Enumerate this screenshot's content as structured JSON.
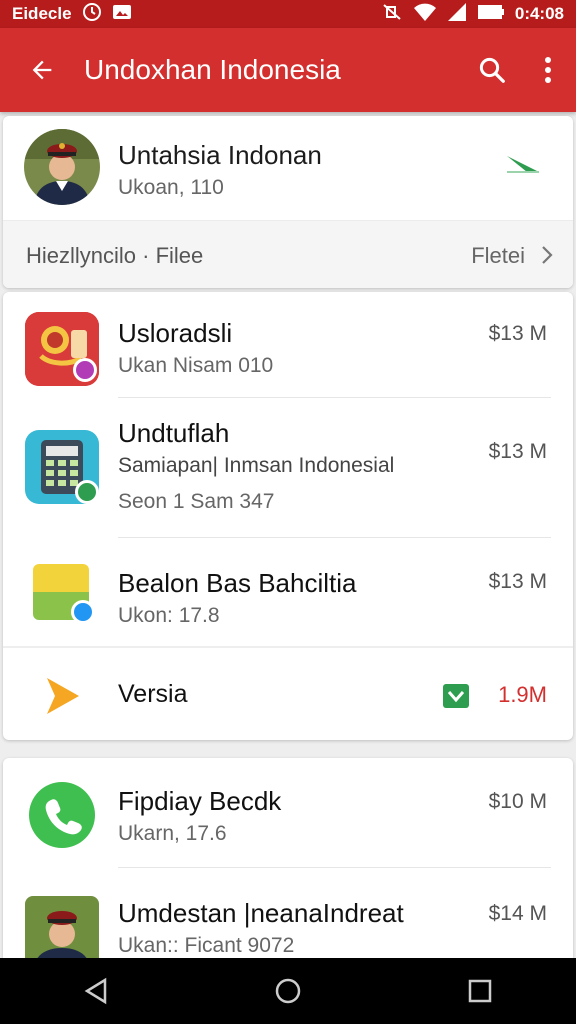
{
  "status_bar": {
    "carrier": "Eidecle",
    "time": "0:4:08"
  },
  "appbar": {
    "title": "Undoхhan Indonesia",
    "back_icon": "arrow-back-icon",
    "search_icon": "search-icon",
    "menu_icon": "more-vert-icon"
  },
  "profile": {
    "name": "Untahsia Indonan",
    "subtitle": "Ukoan, 110",
    "section_label": "Hiezllyncilo · Filee",
    "section_link": "Fletei"
  },
  "apps": [
    {
      "title": "Usloradsli",
      "subtitle": "Ukan Nisam 010",
      "size": "$13 M"
    },
    {
      "title": "Undtuflah",
      "subtitle": "Samiapan| Inmsan Indonesial",
      "subtitle2": "Seon 1 Sam 347",
      "size": "$13 M"
    },
    {
      "title": "Bealon Bas Bahciltia",
      "subtitle": "Ukon: 17.8",
      "size": "$13 M"
    },
    {
      "title": "Versia",
      "size": "1.9M"
    }
  ],
  "apps2": [
    {
      "title": "Fipdiay Becdk",
      "subtitle": "Ukarn, 17.6",
      "size": "$10 M"
    },
    {
      "title": "Umdestan |neanaIndreat",
      "subtitle": "Ukan:: Ficant 9072",
      "size": "$14 M"
    }
  ],
  "colors": {
    "statusbar": "#b71c1c",
    "appbar": "#d32f2f",
    "accent_red": "#d32f2f",
    "accent_green": "#2e9d4f"
  }
}
